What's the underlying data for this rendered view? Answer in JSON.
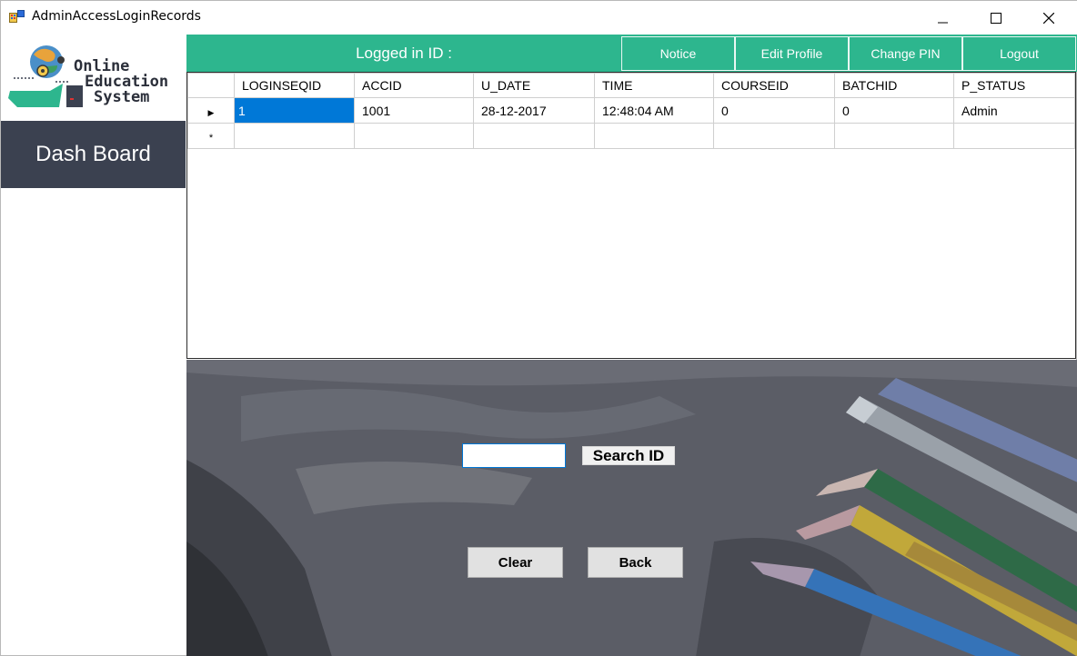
{
  "window": {
    "title": "AdminAccessLoginRecords"
  },
  "logo": {
    "line1": "Online",
    "line2": "Education",
    "line3": "System"
  },
  "sidebar": {
    "dashboard_label": "Dash Board"
  },
  "topbar": {
    "logged_in_label": "Logged in ID :",
    "buttons": [
      {
        "label": "Notice"
      },
      {
        "label": "Edit Profile"
      },
      {
        "label": "Change PIN"
      },
      {
        "label": "Logout"
      }
    ]
  },
  "grid": {
    "columns": [
      "LOGINSEQID",
      "ACCID",
      "U_DATE",
      "TIME",
      "COURSEID",
      "BATCHID",
      "P_STATUS"
    ],
    "rows": [
      [
        "1",
        "1001",
        "28-12-2017",
        "12:48:04 AM",
        "0",
        "0",
        "Admin"
      ]
    ],
    "current_row_marker": "▶",
    "new_row_marker": "*"
  },
  "search": {
    "input_value": "",
    "button_label": "Search ID"
  },
  "actions": {
    "clear_label": "Clear",
    "back_label": "Back"
  },
  "colors": {
    "accent": "#2db68e",
    "sidebar": "#3b4150",
    "selection": "#0078d7"
  }
}
